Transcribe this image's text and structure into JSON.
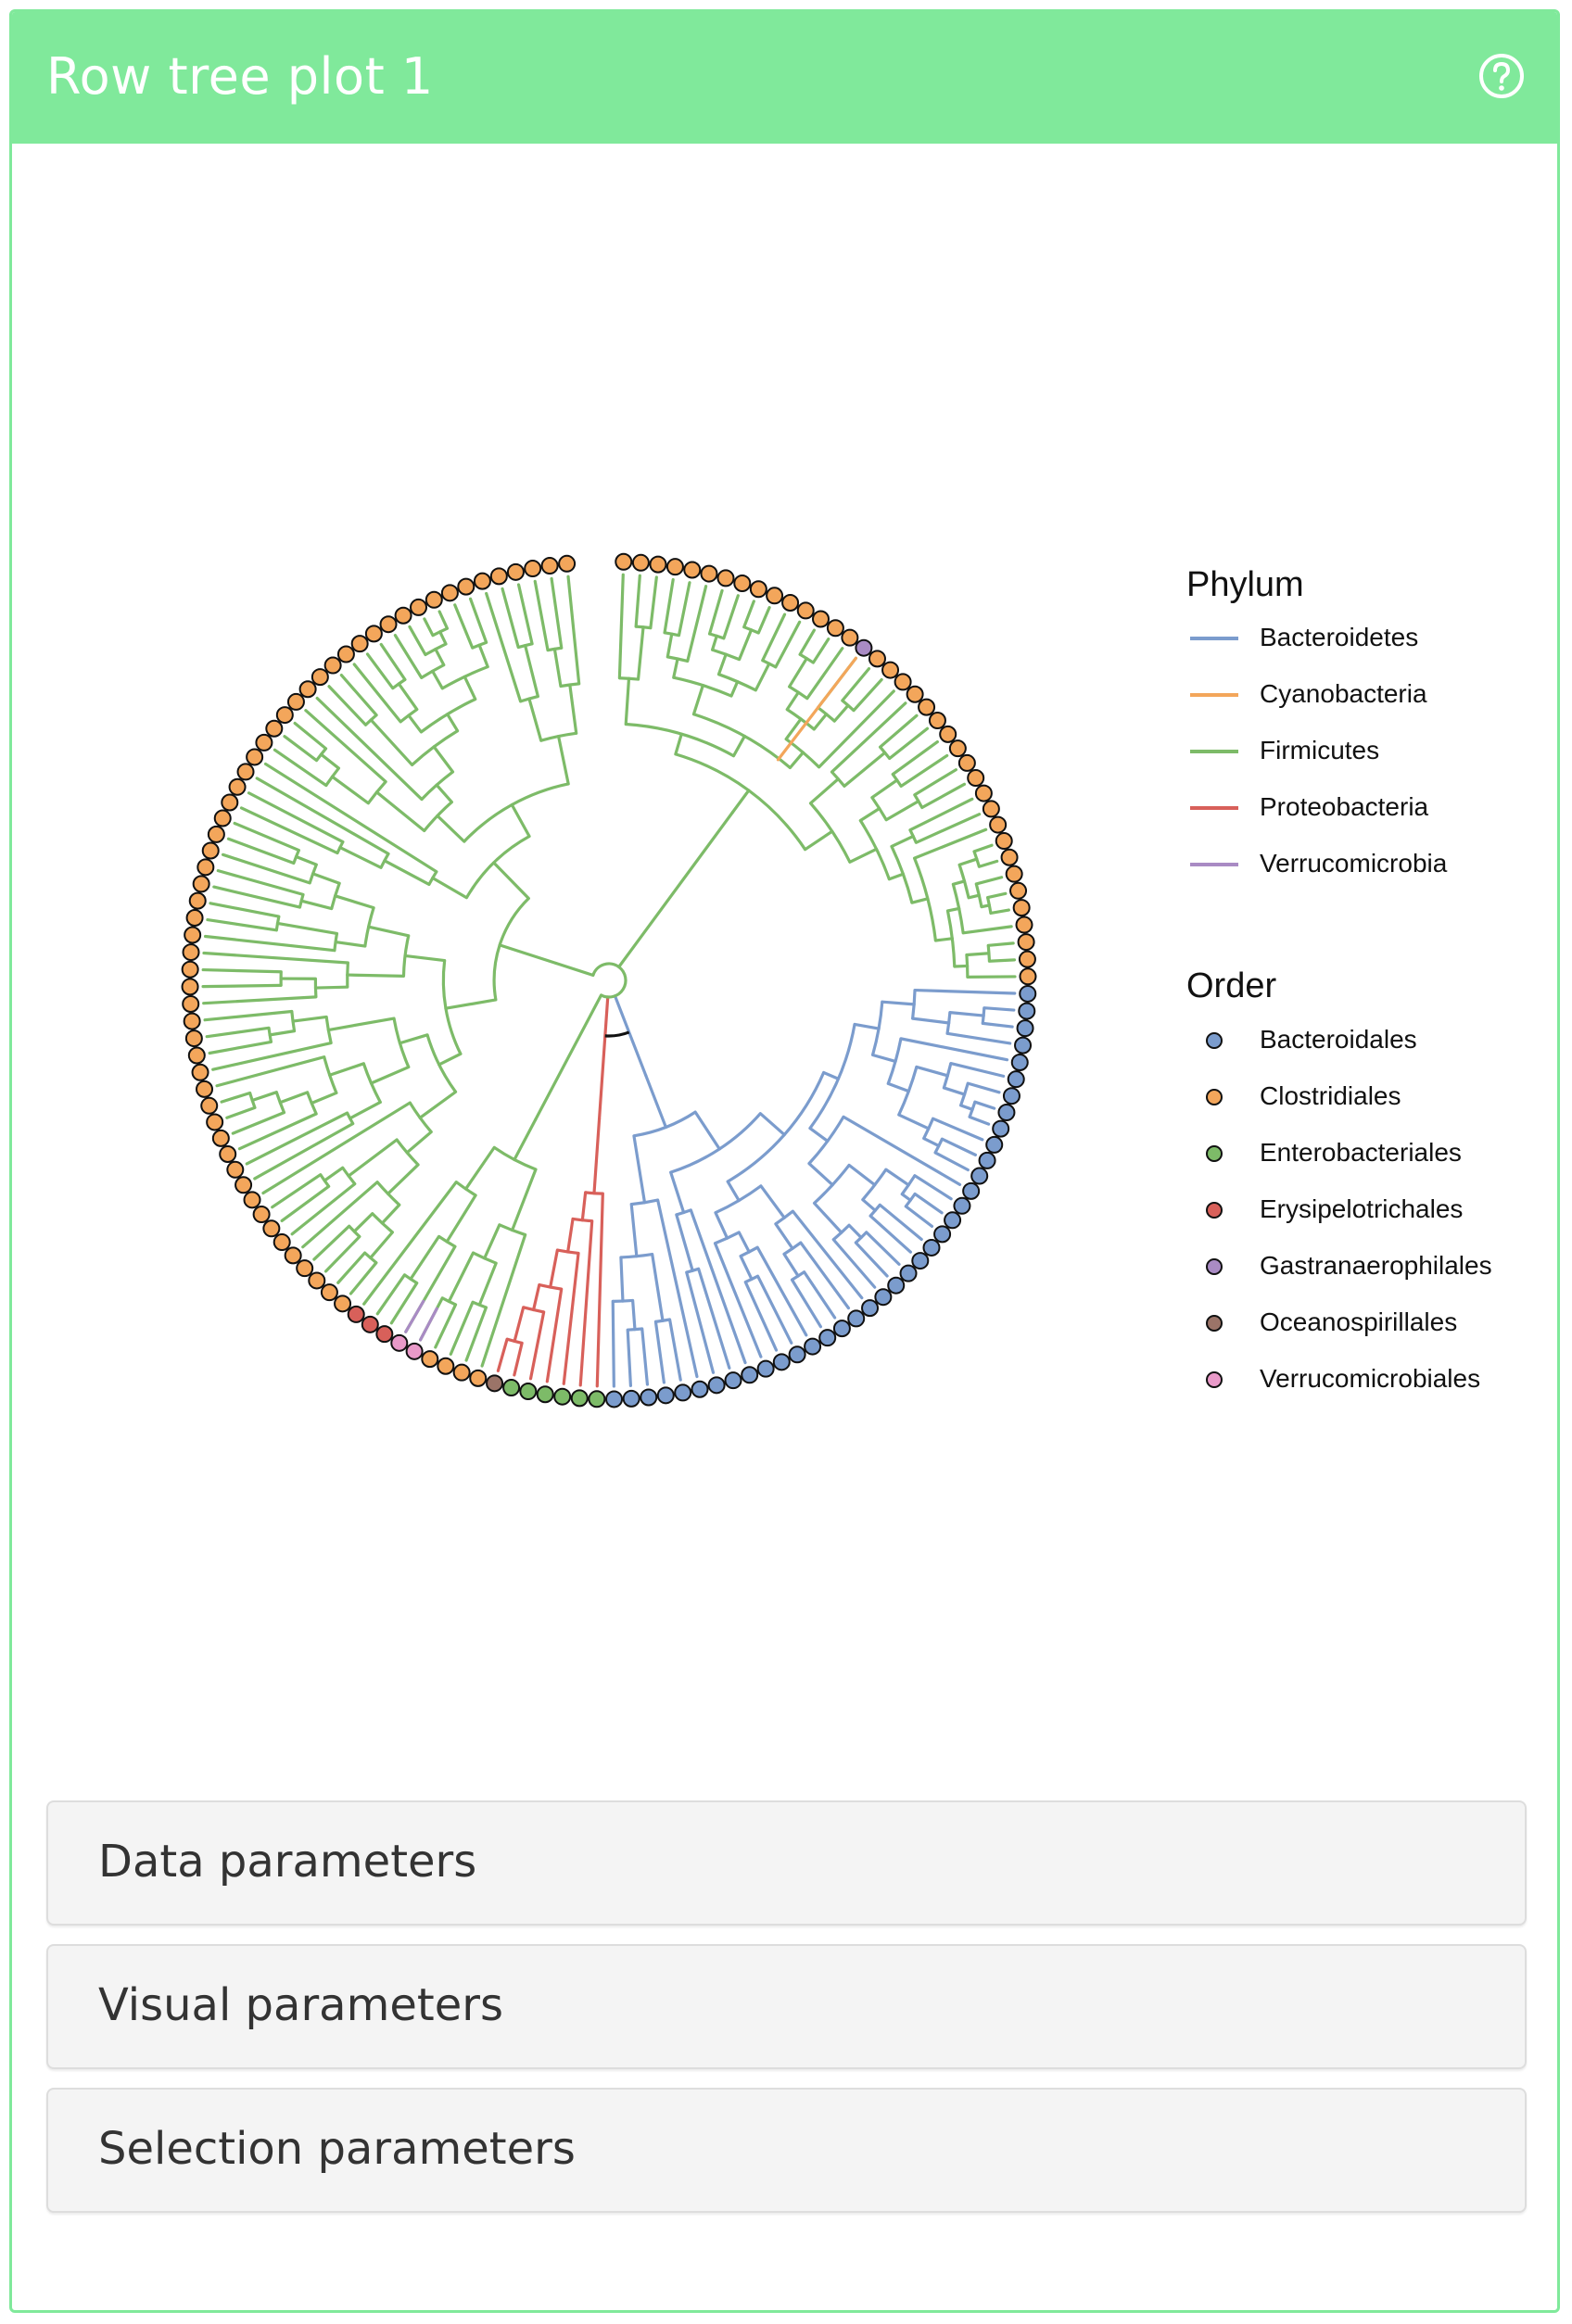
{
  "panel": {
    "title": "Row tree plot 1",
    "help_icon": "question-circle-icon"
  },
  "legend": {
    "phylum": {
      "title": "Phylum",
      "items": [
        {
          "label": "Bacteroidetes",
          "color": "#7b9ccd"
        },
        {
          "label": "Cyanobacteria",
          "color": "#f3a65b"
        },
        {
          "label": "Firmicutes",
          "color": "#7dbb68"
        },
        {
          "label": "Proteobacteria",
          "color": "#d8605a"
        },
        {
          "label": "Verrucomicrobia",
          "color": "#a98bc4"
        }
      ]
    },
    "order": {
      "title": "Order",
      "items": [
        {
          "label": "Bacteroidales",
          "color": "#7b9ccd"
        },
        {
          "label": "Clostridiales",
          "color": "#f3a65b"
        },
        {
          "label": "Enterobacteriales",
          "color": "#7dbb68"
        },
        {
          "label": "Erysipelotrichales",
          "color": "#d8605a"
        },
        {
          "label": "Gastranaerophilales",
          "color": "#a98bc4"
        },
        {
          "label": "Oceanospirillales",
          "color": "#9b7468"
        },
        {
          "label": "Verrucomicrobiales",
          "color": "#e99ac9"
        }
      ]
    }
  },
  "sections": [
    {
      "label": "Data parameters"
    },
    {
      "label": "Visual parameters"
    },
    {
      "label": "Selection parameters"
    }
  ]
}
